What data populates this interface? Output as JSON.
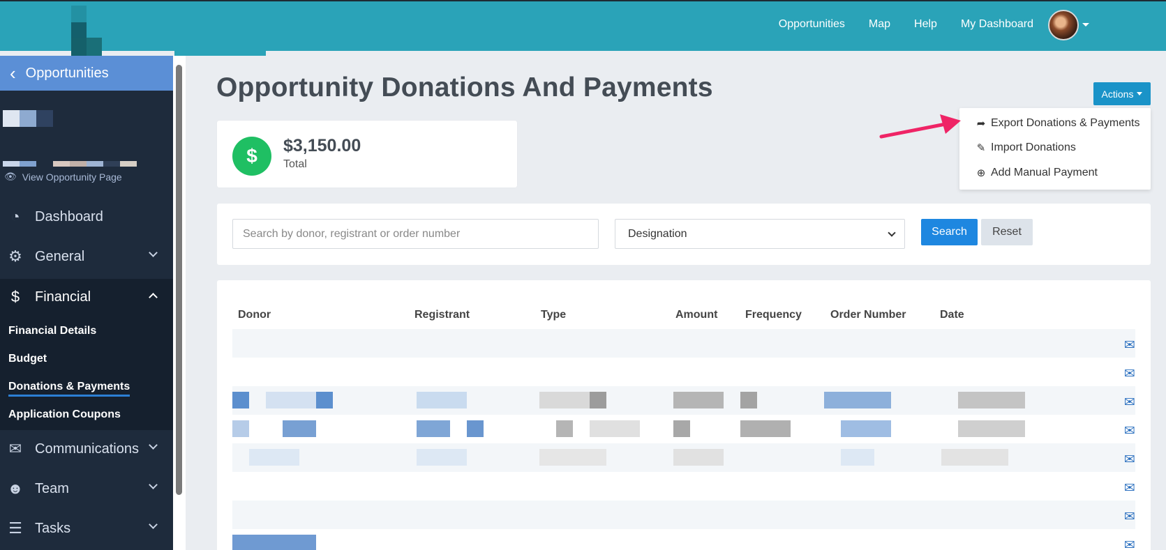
{
  "topbar": {
    "links": [
      "Opportunities",
      "Map",
      "Help",
      "My Dashboard"
    ]
  },
  "sidebar": {
    "back_label": "Opportunities",
    "view_page": "View Opportunity Page",
    "items": {
      "dashboard": "Dashboard",
      "general": "General",
      "financial": "Financial",
      "communications": "Communications",
      "team": "Team",
      "tasks": "Tasks"
    },
    "financial_sub": {
      "details": "Financial Details",
      "budget": "Budget",
      "donations": "Donations & Payments",
      "coupons": "Application Coupons"
    }
  },
  "page": {
    "title": "Opportunity Donations And Payments"
  },
  "summary": {
    "icon_symbol": "$",
    "amount": "$3,150.00",
    "label": "Total"
  },
  "actions": {
    "button_label": "Actions",
    "menu": {
      "export": "Export Donations & Payments",
      "import": "Import Donations",
      "manual": "Add Manual Payment"
    }
  },
  "filters": {
    "search_placeholder": "Search by donor, registrant or order number",
    "designation": "Designation",
    "search_label": "Search",
    "reset_label": "Reset"
  },
  "table": {
    "headers": {
      "donor": "Donor",
      "registrant": "Registrant",
      "type": "Type",
      "amount": "Amount",
      "frequency": "Frequency",
      "order": "Order Number",
      "date": "Date"
    }
  },
  "colors": {
    "topbar": "#2aa3b8",
    "sidebar": "#1e2b3c",
    "accent_blue": "#1e87e0",
    "success_green": "#1fbf63",
    "arrow": "#ef2466"
  }
}
